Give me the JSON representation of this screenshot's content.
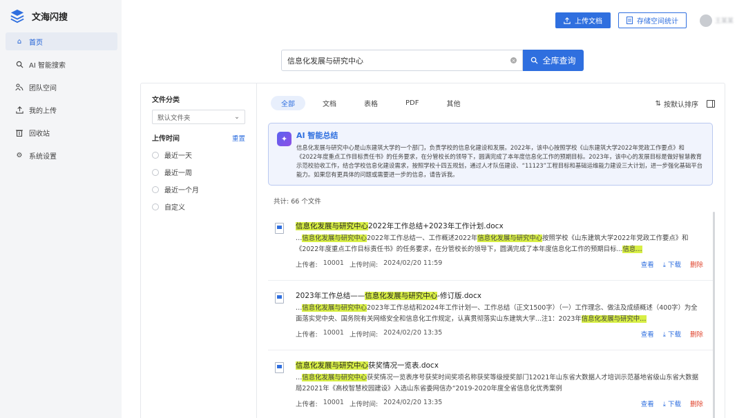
{
  "brand": {
    "name": "文海闪搜"
  },
  "nav": [
    {
      "label": "首页",
      "icon": "home-icon",
      "active": true
    },
    {
      "label": "AI 智能搜索",
      "icon": "search-icon"
    },
    {
      "label": "团队空间",
      "icon": "team-icon"
    },
    {
      "label": "我的上传",
      "icon": "upload-icon"
    },
    {
      "label": "回收站",
      "icon": "trash-icon"
    },
    {
      "label": "系统设置",
      "icon": "gear-icon"
    }
  ],
  "header": {
    "upload_label": "上传文档",
    "storage_label": "存储空间统计",
    "user_name": "王某某"
  },
  "search": {
    "value": "信息化发展与研究中心",
    "button_label": "全库查询"
  },
  "filter": {
    "category_title": "文件分类",
    "category_selected": "默认文件夹",
    "time_title": "上传时间",
    "reset_label": "重置",
    "time_options": [
      "最近一天",
      "最近一周",
      "最近一个月",
      "自定义"
    ]
  },
  "tabs": [
    "全部",
    "文档",
    "表格",
    "PDF",
    "其他"
  ],
  "sort_label": "按默认排序",
  "ai_summary": {
    "title": "AI 智能总结",
    "body": "信息化发展与研究中心是山东建筑大学的一个部门，负责学校的信息化建设和发展。2022年，该中心按照学校《山东建筑大学2022年党政工作要点》和《2022年度重点工作目标责任书》的任务要求，在分管校长的领导下，圆满完成了本年度信息化工作的预期目标。2023年，该中心的发展目标是做好智慧教育示范校验收工作，结合学校信息化建设需求，按照学校十四五规划，通过人才队伍建设、“11123”工程目标和基础运维能力建设三大计划，进一步强化基础平台能力。如果您有更具体的问题或需要进一步的信息，请告诉我。"
  },
  "count_label": "共计:  66 个文件",
  "results": [
    {
      "title_hl": "信息化发展与研究中心",
      "title_rest": "2022年工作总结+2023年工作计划.docx",
      "snippet_prefix": "…",
      "snippet_hl1": "信息化发展与研究中心",
      "snippet_mid": "2022年工作总结一、工作概述2022年",
      "snippet_hl2": "信息化发展与研究中心",
      "snippet_rest": "按照学校《山东建筑大学2022年党政工作要点》和《2022年度重点工作目标责任书》的任务要求，在分管校长的领导下，圆满完成了本年度信息化工作的预期目标...",
      "snippet_hl3": "信息…",
      "uploader_label": "上传者:",
      "uploader": "10001",
      "time_label": "上传时间:",
      "time": "2024/02/20 11:59",
      "view": "查看",
      "download": "下载",
      "delete": "删除"
    },
    {
      "title_pre": "2023年工作总结——",
      "title_hl": "信息化发展与研究中心",
      "title_rest": "-修订版.docx",
      "snippet_prefix": "…",
      "snippet_hl1": "信息化发展与研究中心",
      "snippet_mid": "2023年工作总结和2024年工作计划一、工作总结（正文1500字）（一）工作理念、做法及成绩概述（400字）为全面落实党中央、国务院有关网络安全和信息化工作规定，认真贯彻落实山东建筑大学...注1：2023年",
      "snippet_hl2": "信息化发展与研究中…",
      "uploader_label": "上传者:",
      "uploader": "10001",
      "time_label": "上传时间:",
      "time": "2024/02/20 13:35",
      "view": "查看",
      "download": "下载",
      "delete": "删除"
    },
    {
      "title_hl": "信息化发展与研究中心",
      "title_rest": "获奖情况一览表.docx",
      "snippet_prefix": "…",
      "snippet_hl1": "信息化发展与研究中心",
      "snippet_rest": "获奖情况一览表序号获奖时间奖项名称获奖等级授奖部门12021年山东省大数据人才培训示范基地省级山东省大数据局22021年《高校智慧校园建设》入选山东省委网信办“2019-2020年度全省信息化优秀案例",
      "uploader_label": "上传者:",
      "uploader": "10001",
      "time_label": "上传时间:",
      "time": "2024/02/20 13:35",
      "view": "查看",
      "download": "下载",
      "delete": "删除"
    }
  ],
  "colors": {
    "accent": "#2f6fdf",
    "highlight": "#d8ef45",
    "danger": "#e0462f"
  }
}
